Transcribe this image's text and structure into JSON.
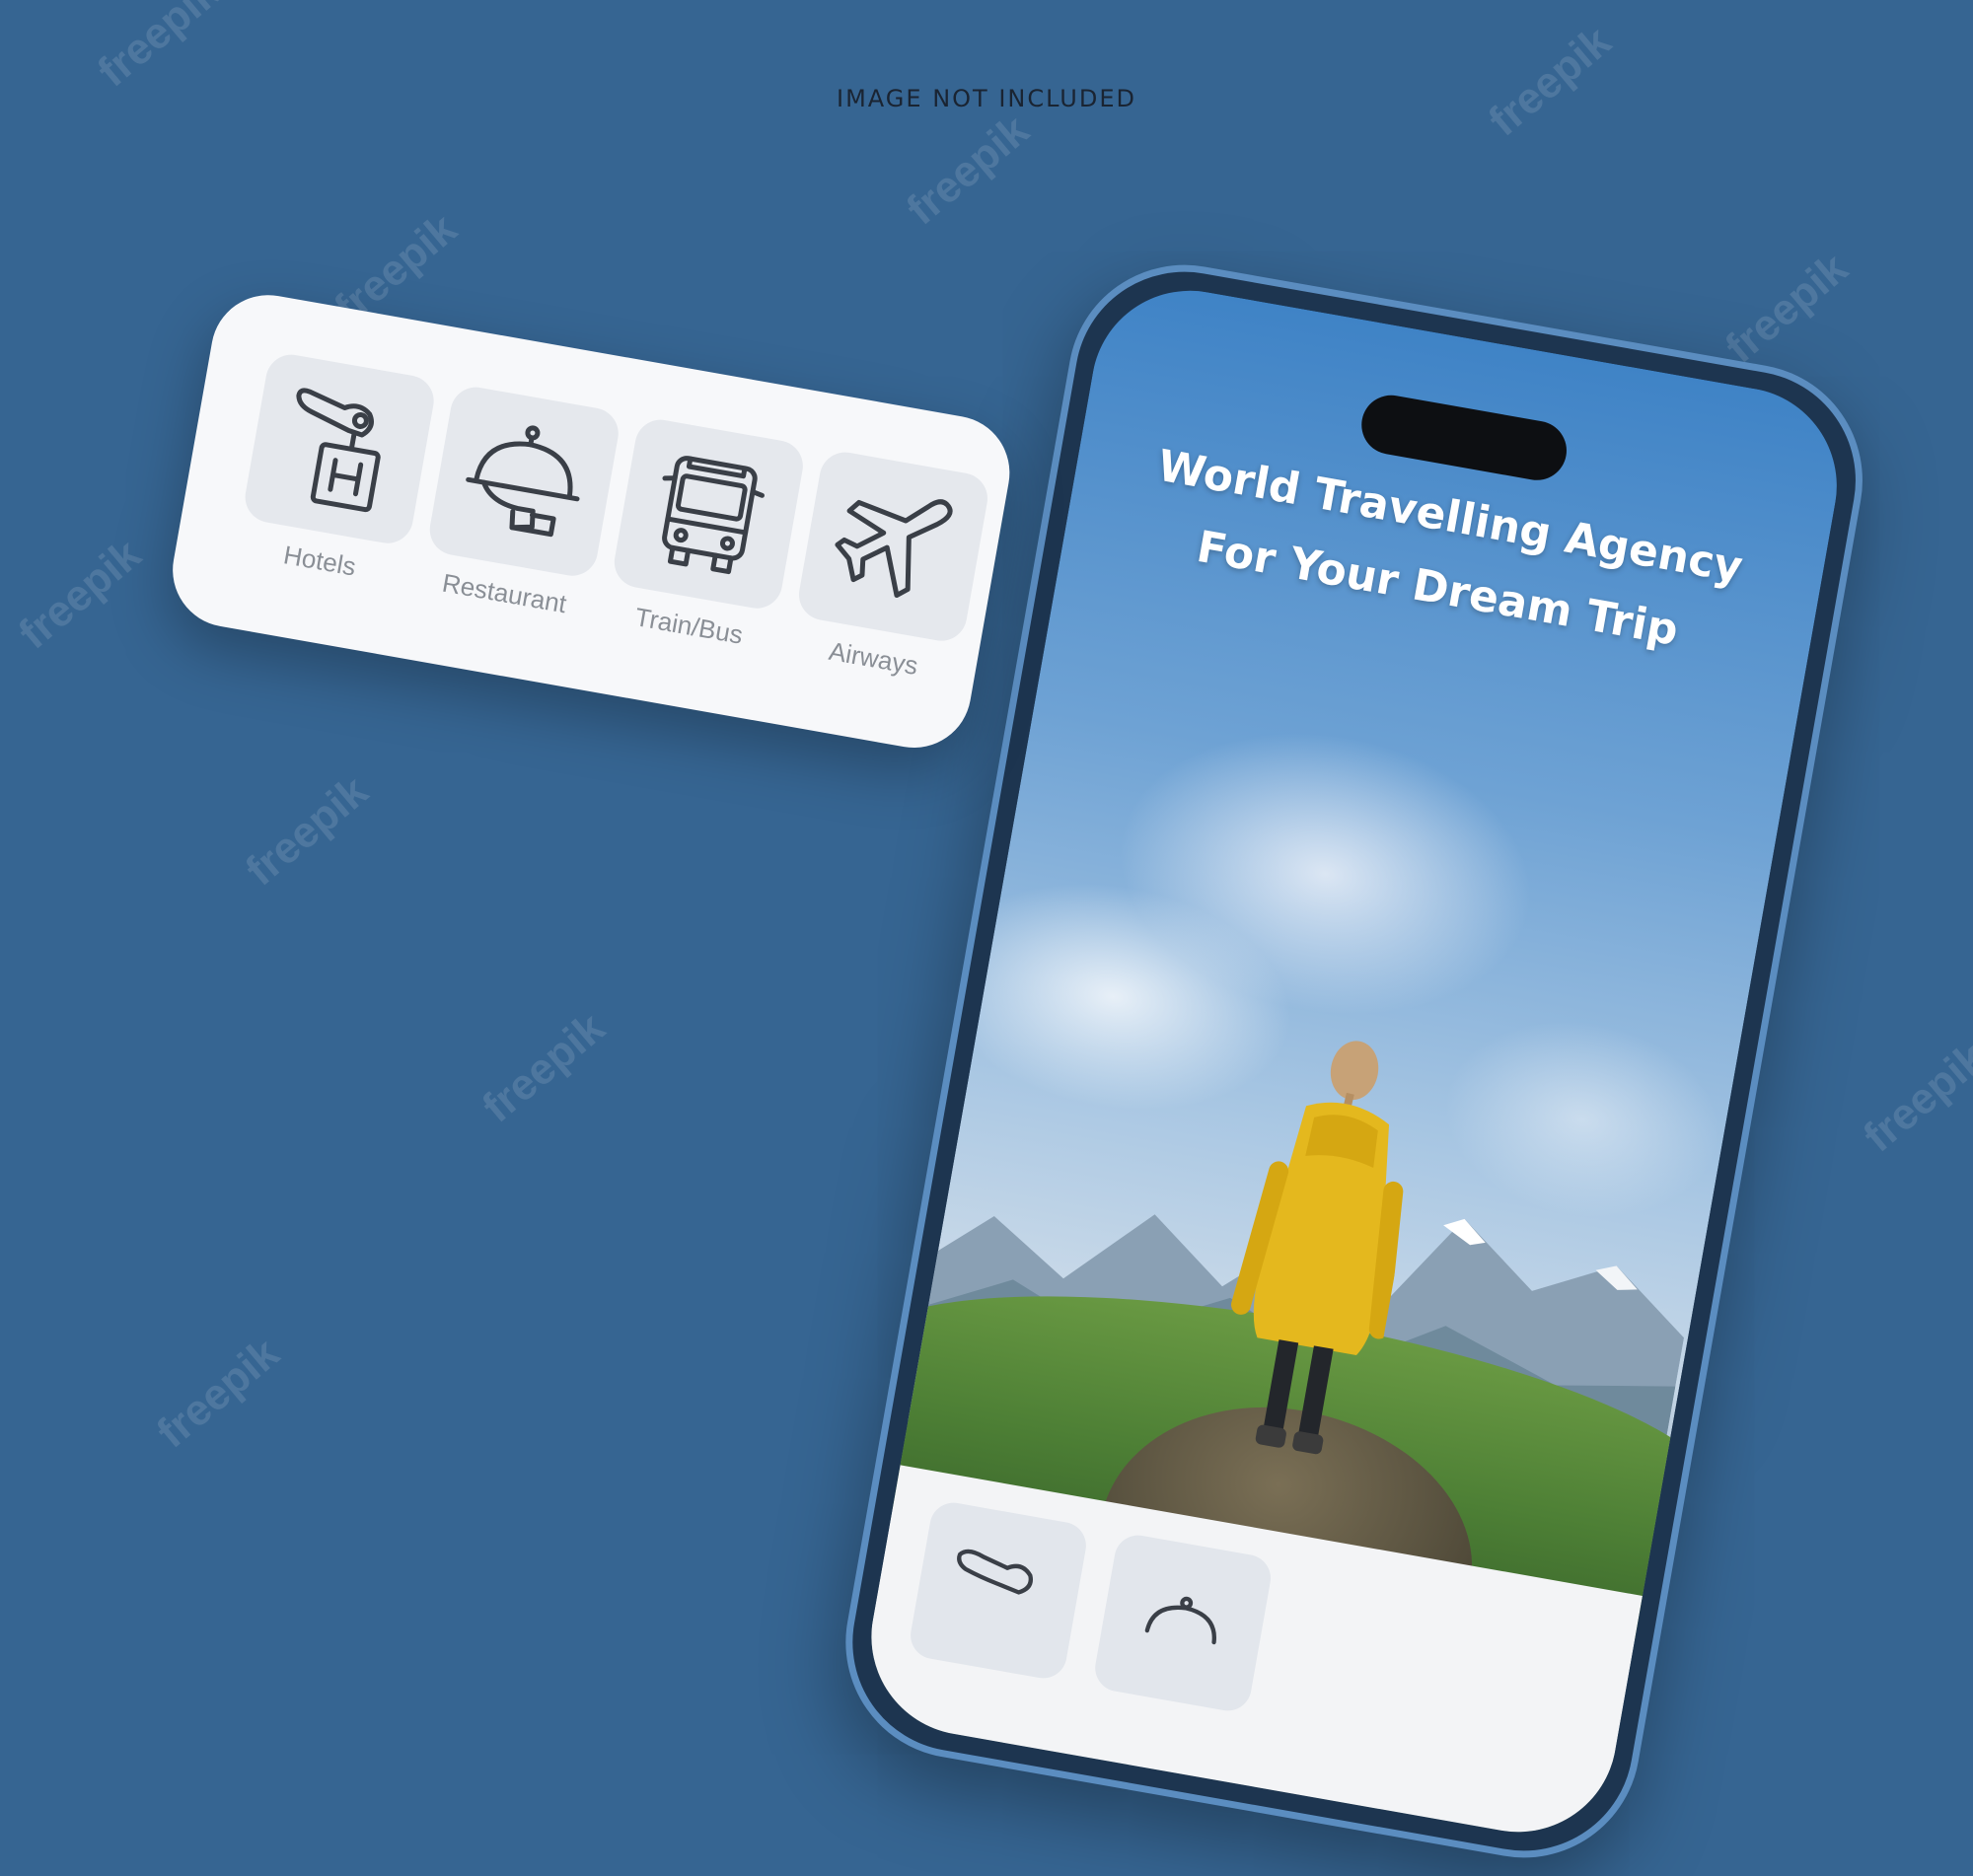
{
  "header": {
    "note": "IMAGE NOT INCLUDED"
  },
  "watermark": {
    "text": "freepik"
  },
  "phone": {
    "hero_line1": "World Travelling Agency",
    "hero_line2": "For Your Dream Trip"
  },
  "services": {
    "items": [
      {
        "label": "Hotels",
        "icon": "hotel-key-icon"
      },
      {
        "label": "Restaurant",
        "icon": "serving-cloche-icon"
      },
      {
        "label": "Train/Bus",
        "icon": "bus-icon"
      },
      {
        "label": "Airways",
        "icon": "airplane-icon"
      }
    ]
  },
  "colors": {
    "background": "#366592",
    "card": "#f7f8fa",
    "tile": "#e5e8ed",
    "icon_stroke": "#3a3f47",
    "label": "#8a8f96",
    "jacket": "#e4b81e"
  }
}
